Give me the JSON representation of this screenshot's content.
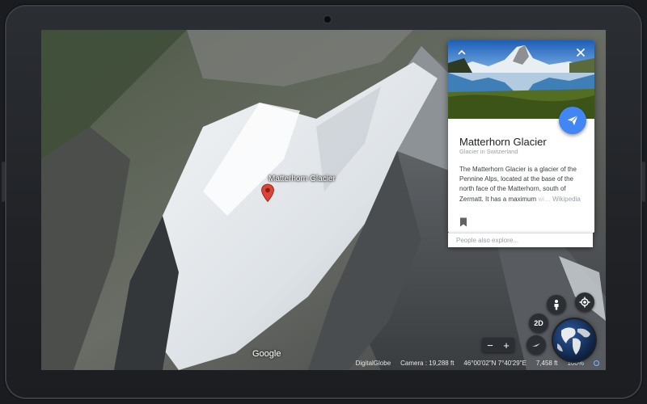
{
  "map": {
    "place_label": "Matterhorn Glacier",
    "logo": "Google"
  },
  "card": {
    "title": "Matterhorn Glacier",
    "subtitle": "Glacier in Switzerland",
    "description_main": "The Matterhorn Glacier is a glacier of the Pennine Alps, located at the base of the north face of the Matterhorn, south of Zermatt. It has a maximum",
    "description_fade": "wi…",
    "description_source": "Wikipedia",
    "icons": {
      "collapse": "chevron-up-icon",
      "close": "close-icon",
      "fly_to": "paper-plane-icon",
      "bookmark": "bookmark-icon"
    },
    "fab_color": "#4285f4"
  },
  "explore": {
    "placeholder": "People also explore..."
  },
  "controls": {
    "mode_toggle": "2D",
    "zoom_out": "−",
    "zoom_in": "+",
    "icons": {
      "street_view": "pegman-icon",
      "my_location": "locate-icon",
      "compass": "compass-icon",
      "globe": "globe-icon"
    }
  },
  "status": {
    "attribution": "DigitalGlobe",
    "camera": "Camera : 19,288 ft",
    "coords": "46°00'02\"N 7°40'29\"E",
    "elevation": "7,458 ft",
    "loaded": "100%"
  }
}
